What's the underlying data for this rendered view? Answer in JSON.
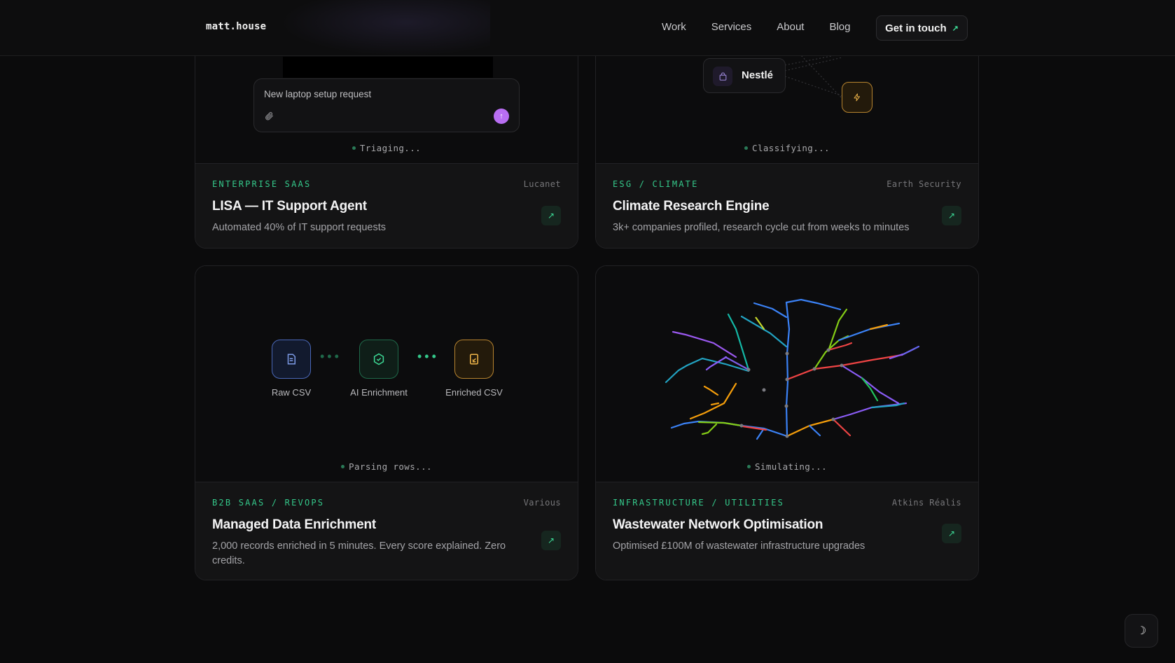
{
  "header": {
    "logo": "matt.house",
    "nav": [
      {
        "label": "Work"
      },
      {
        "label": "Services"
      },
      {
        "label": "About"
      },
      {
        "label": "Blog"
      }
    ],
    "cta_label": "Get in touch",
    "cta_icon": "arrow-up-right-icon"
  },
  "projects": [
    {
      "status": "Triaging...",
      "tag": "ENTERPRISE SAAS",
      "client": "Lucanet",
      "title": "LISA — IT Support Agent",
      "description": "Automated 40% of IT support requests",
      "visual": {
        "input_placeholder": "New laptop setup request",
        "attach_icon": "paperclip-icon",
        "send_icon": "arrow-up-icon",
        "send_color": "#b86ef2"
      }
    },
    {
      "status": "Classifying...",
      "tag": "ESG / CLIMATE",
      "client": "Earth Security",
      "title": "Climate Research Engine",
      "description": "3k+ companies profiled, research cycle cut from weeks to minutes",
      "visual": {
        "company_name": "Nestlé",
        "company_icon": "shopping-bag-icon",
        "node_icon": "lightning-icon"
      }
    },
    {
      "status": "Parsing rows...",
      "tag": "B2B SAAS / REVOPS",
      "client": "Various",
      "title": "Managed Data Enrichment",
      "description": "2,000 records enriched in 5 minutes. Every score explained. Zero credits.",
      "visual": {
        "steps": [
          {
            "label": "Raw CSV",
            "icon": "document-icon",
            "color": "#5b7fd6"
          },
          {
            "label": "AI Enrichment",
            "icon": "hexagon-check-icon",
            "color": "#34c88a"
          },
          {
            "label": "Enriched CSV",
            "icon": "checked-document-icon",
            "color": "#e5a33a"
          }
        ]
      }
    },
    {
      "status": "Simulating...",
      "tag": "INFRASTRUCTURE / UTILITIES",
      "client": "Atkins Réalis",
      "title": "Wastewater Network Optimisation",
      "description": "Optimised £100M of wastewater infrastructure upgrades"
    }
  ],
  "theme_toggle_icon": "moon-icon",
  "colors": {
    "accent": "#34c88a",
    "background": "#0b0b0c",
    "card": "#141415"
  }
}
